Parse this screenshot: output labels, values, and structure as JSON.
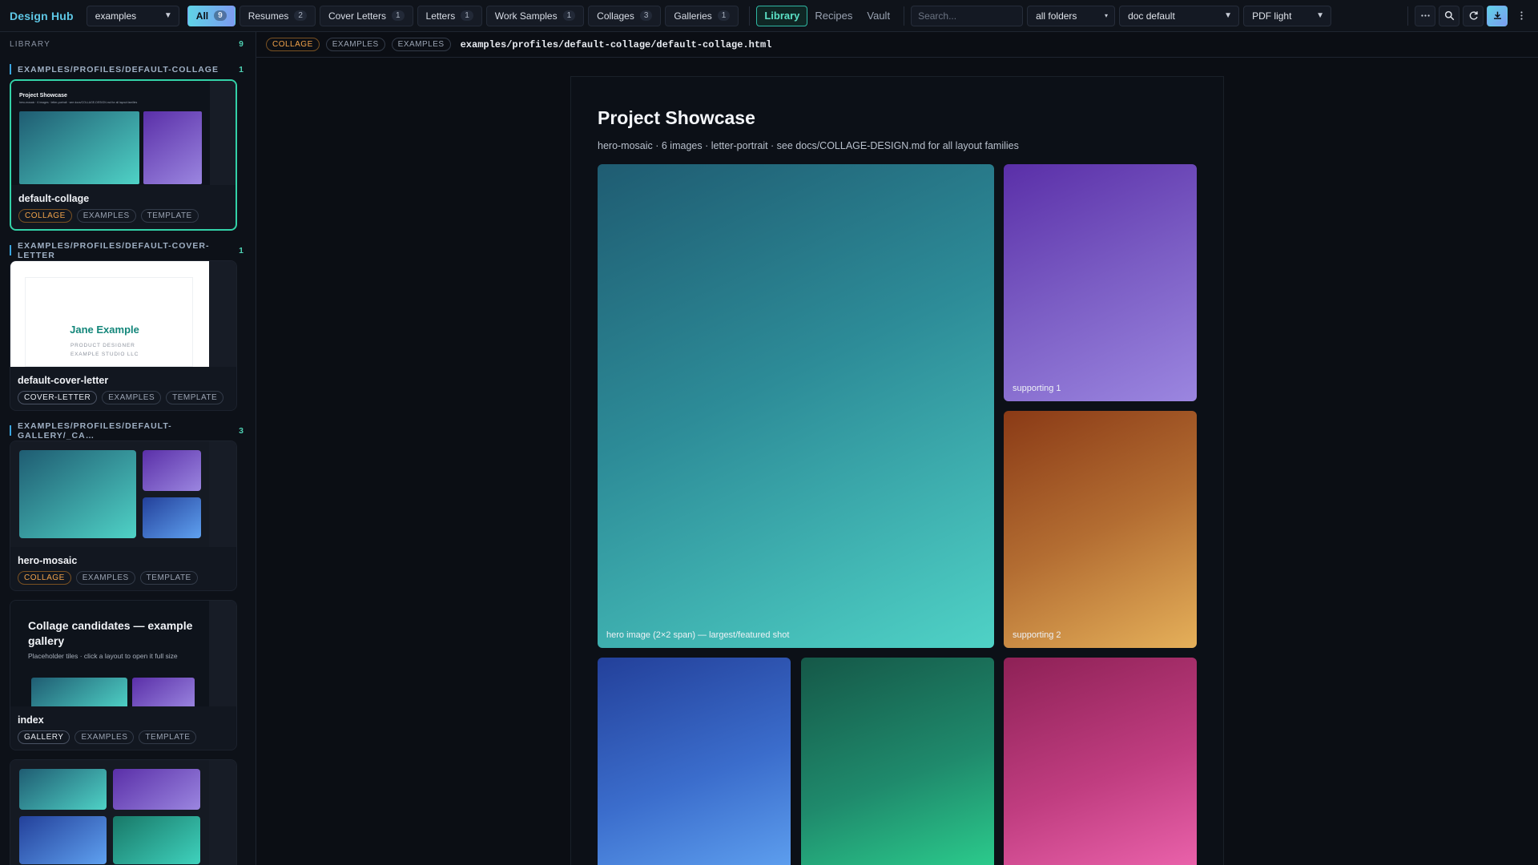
{
  "app": {
    "brand": "Design Hub"
  },
  "topbar": {
    "profile_select": "examples",
    "tabs": [
      {
        "label": "All",
        "count": "9"
      },
      {
        "label": "Resumes",
        "count": "2"
      },
      {
        "label": "Cover Letters",
        "count": "1"
      },
      {
        "label": "Letters",
        "count": "1"
      },
      {
        "label": "Work Samples",
        "count": "1"
      },
      {
        "label": "Collages",
        "count": "3"
      },
      {
        "label": "Galleries",
        "count": "1"
      }
    ],
    "nav": [
      "Library",
      "Recipes",
      "Vault"
    ],
    "search_placeholder": "Search...",
    "folder_select": "all folders",
    "doc_select": "doc default",
    "pdf_select": "PDF light",
    "icons": [
      "more-icon",
      "search-icon",
      "refresh-icon",
      "download-icon",
      "kebab-icon"
    ]
  },
  "sidebar": {
    "heading": "LIBRARY",
    "total": "9",
    "groups": [
      {
        "path": "EXAMPLES/PROFILES/DEFAULT-COLLAGE",
        "count": "1",
        "card": {
          "title": "default-collage",
          "tags": [
            "COLLAGE",
            "EXAMPLES",
            "TEMPLATE"
          ],
          "thumb_title": "Project Showcase",
          "thumb_sub": "hero-mosaic · 6 images · letter-portrait · see docs/COLLAGE-DESIGN.md for all layout families"
        }
      },
      {
        "path": "EXAMPLES/PROFILES/DEFAULT-COVER-LETTER",
        "count": "1",
        "card": {
          "title": "default-cover-letter",
          "tags": [
            "COVER-LETTER",
            "EXAMPLES",
            "TEMPLATE"
          ],
          "thumb_name": "Jane Example",
          "thumb_line1": "PRODUCT DESIGNER",
          "thumb_line2": "EXAMPLE STUDIO LLC"
        }
      },
      {
        "path": "EXAMPLES/PROFILES/DEFAULT-GALLERY/_CA…",
        "count": "3",
        "cards": [
          {
            "title": "hero-mosaic",
            "tags": [
              "COLLAGE",
              "EXAMPLES",
              "TEMPLATE"
            ]
          },
          {
            "title": "index",
            "tags": [
              "GALLERY",
              "EXAMPLES",
              "TEMPLATE"
            ],
            "thumb_title": "Collage candidates — example gallery",
            "thumb_sub": "Placeholder tiles · click a layout to open it full size"
          }
        ]
      }
    ]
  },
  "pathbar": {
    "tags": [
      "COLLAGE",
      "EXAMPLES",
      "EXAMPLES"
    ],
    "path": "examples/profiles/default-collage/default-collage.html"
  },
  "document": {
    "title": "Project Showcase",
    "subtitle": "hero-mosaic · 6 images · letter-portrait · see docs/COLLAGE-DESIGN.md for all layout families",
    "tiles": [
      {
        "caption": "hero image (2×2 span) — largest/featured shot"
      },
      {
        "caption": "supporting 1"
      },
      {
        "caption": "supporting 2"
      }
    ]
  },
  "colors": {
    "accent": "#33d2a8",
    "teal_gradient": [
      "#1f5c72",
      "#4fd2c6"
    ],
    "purple_gradient": [
      "#5a2fa8",
      "#9b86e0"
    ],
    "orange_gradient": [
      "#8a3a16",
      "#e5b05a"
    ],
    "blue_gradient": [
      "#23409a",
      "#5fa1f0"
    ],
    "green_gradient": [
      "#155848",
      "#2ccf8e"
    ],
    "pink_gradient": [
      "#8e2156",
      "#ec64ad"
    ]
  }
}
